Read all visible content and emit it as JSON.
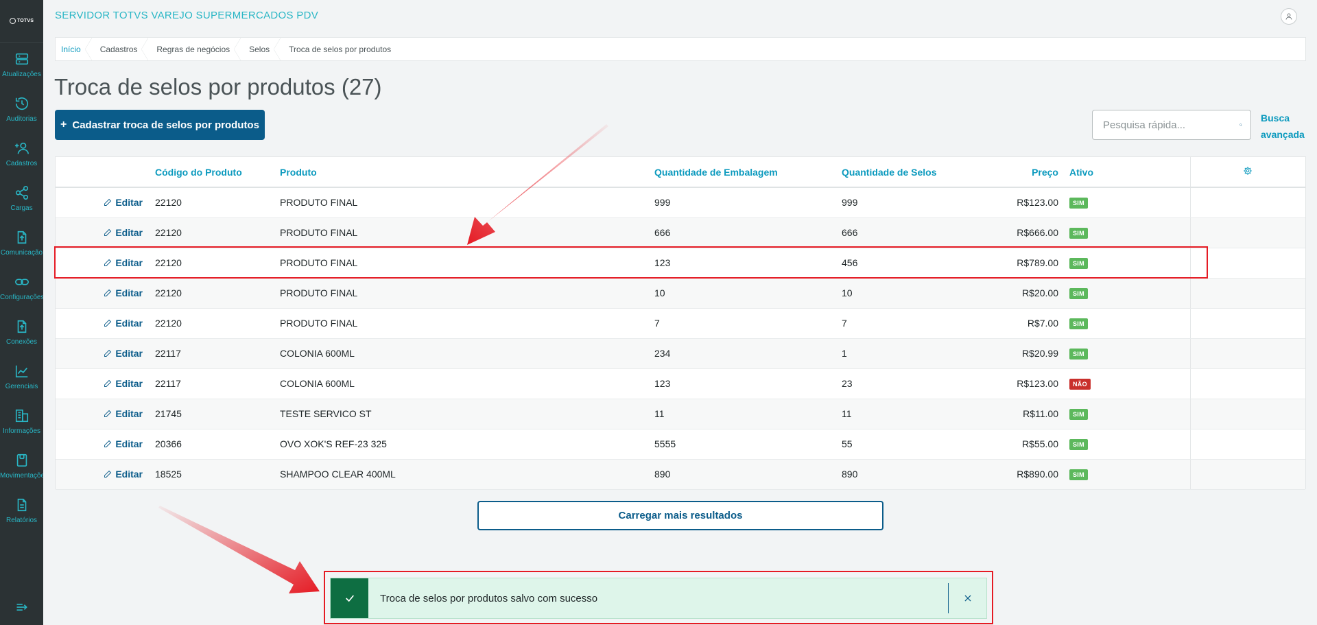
{
  "app_title": "SERVIDOR TOTVS VAREJO SUPERMERCADOS PDV",
  "logo_text": "TOTVS",
  "sidebar": {
    "items": [
      {
        "label": "Atualizações",
        "icon": "server-icon"
      },
      {
        "label": "Auditorias",
        "icon": "history-icon"
      },
      {
        "label": "Cadastros",
        "icon": "add-user-icon"
      },
      {
        "label": "Cargas",
        "icon": "share-icon"
      },
      {
        "label": "Comunicação",
        "icon": "file-upload-icon"
      },
      {
        "label": "Configurações",
        "icon": "link-icon"
      },
      {
        "label": "Conexões",
        "icon": "file-upload-icon"
      },
      {
        "label": "Gerenciais",
        "icon": "chart-line-icon"
      },
      {
        "label": "Informações",
        "icon": "buildings-icon"
      },
      {
        "label": "Movimentações",
        "icon": "clipboard-icon"
      },
      {
        "label": "Relatórios",
        "icon": "document-icon"
      }
    ]
  },
  "breadcrumb": [
    "Início",
    "Cadastros",
    "Regras de negócios",
    "Selos",
    "Troca de selos por produtos"
  ],
  "page_title": "Troca de selos por produtos (27)",
  "create_button": "Cadastrar troca de selos por produtos",
  "search": {
    "placeholder": "Pesquisa rápida..."
  },
  "advanced_search": "Busca avançada",
  "table": {
    "headers": {
      "code": "Código do Produto",
      "product": "Produto",
      "pack_qty": "Quantidade de Embalagem",
      "stamp_qty": "Quantidade de Selos",
      "price": "Preço",
      "active": "Ativo"
    },
    "edit_label": "Editar",
    "rows": [
      {
        "code": "22120",
        "product": "PRODUTO FINAL",
        "pack_qty": "999",
        "stamp_qty": "999",
        "price": "R$123.00",
        "active": "SIM"
      },
      {
        "code": "22120",
        "product": "PRODUTO FINAL",
        "pack_qty": "666",
        "stamp_qty": "666",
        "price": "R$666.00",
        "active": "SIM"
      },
      {
        "code": "22120",
        "product": "PRODUTO FINAL",
        "pack_qty": "123",
        "stamp_qty": "456",
        "price": "R$789.00",
        "active": "SIM"
      },
      {
        "code": "22120",
        "product": "PRODUTO FINAL",
        "pack_qty": "10",
        "stamp_qty": "10",
        "price": "R$20.00",
        "active": "SIM"
      },
      {
        "code": "22120",
        "product": "PRODUTO FINAL",
        "pack_qty": "7",
        "stamp_qty": "7",
        "price": "R$7.00",
        "active": "SIM"
      },
      {
        "code": "22117",
        "product": "COLONIA 600ML",
        "pack_qty": "234",
        "stamp_qty": "1",
        "price": "R$20.99",
        "active": "SIM"
      },
      {
        "code": "22117",
        "product": "COLONIA 600ML",
        "pack_qty": "123",
        "stamp_qty": "23",
        "price": "R$123.00",
        "active": "NÃO"
      },
      {
        "code": "21745",
        "product": "TESTE SERVICO ST",
        "pack_qty": "11",
        "stamp_qty": "11",
        "price": "R$11.00",
        "active": "SIM"
      },
      {
        "code": "20366",
        "product": "OVO XOK'S REF-23 325",
        "pack_qty": "5555",
        "stamp_qty": "55",
        "price": "R$55.00",
        "active": "SIM"
      },
      {
        "code": "18525",
        "product": "SHAMPOO CLEAR 400ML",
        "pack_qty": "890",
        "stamp_qty": "890",
        "price": "R$890.00",
        "active": "SIM"
      }
    ]
  },
  "load_more": "Carregar mais resultados",
  "toast": {
    "message": "Troca de selos por produtos salvo com sucesso"
  },
  "colors": {
    "accent": "#0c9abe",
    "primary": "#0b5c8a",
    "success": "#0e6e42",
    "annotation": "#e51b24"
  }
}
